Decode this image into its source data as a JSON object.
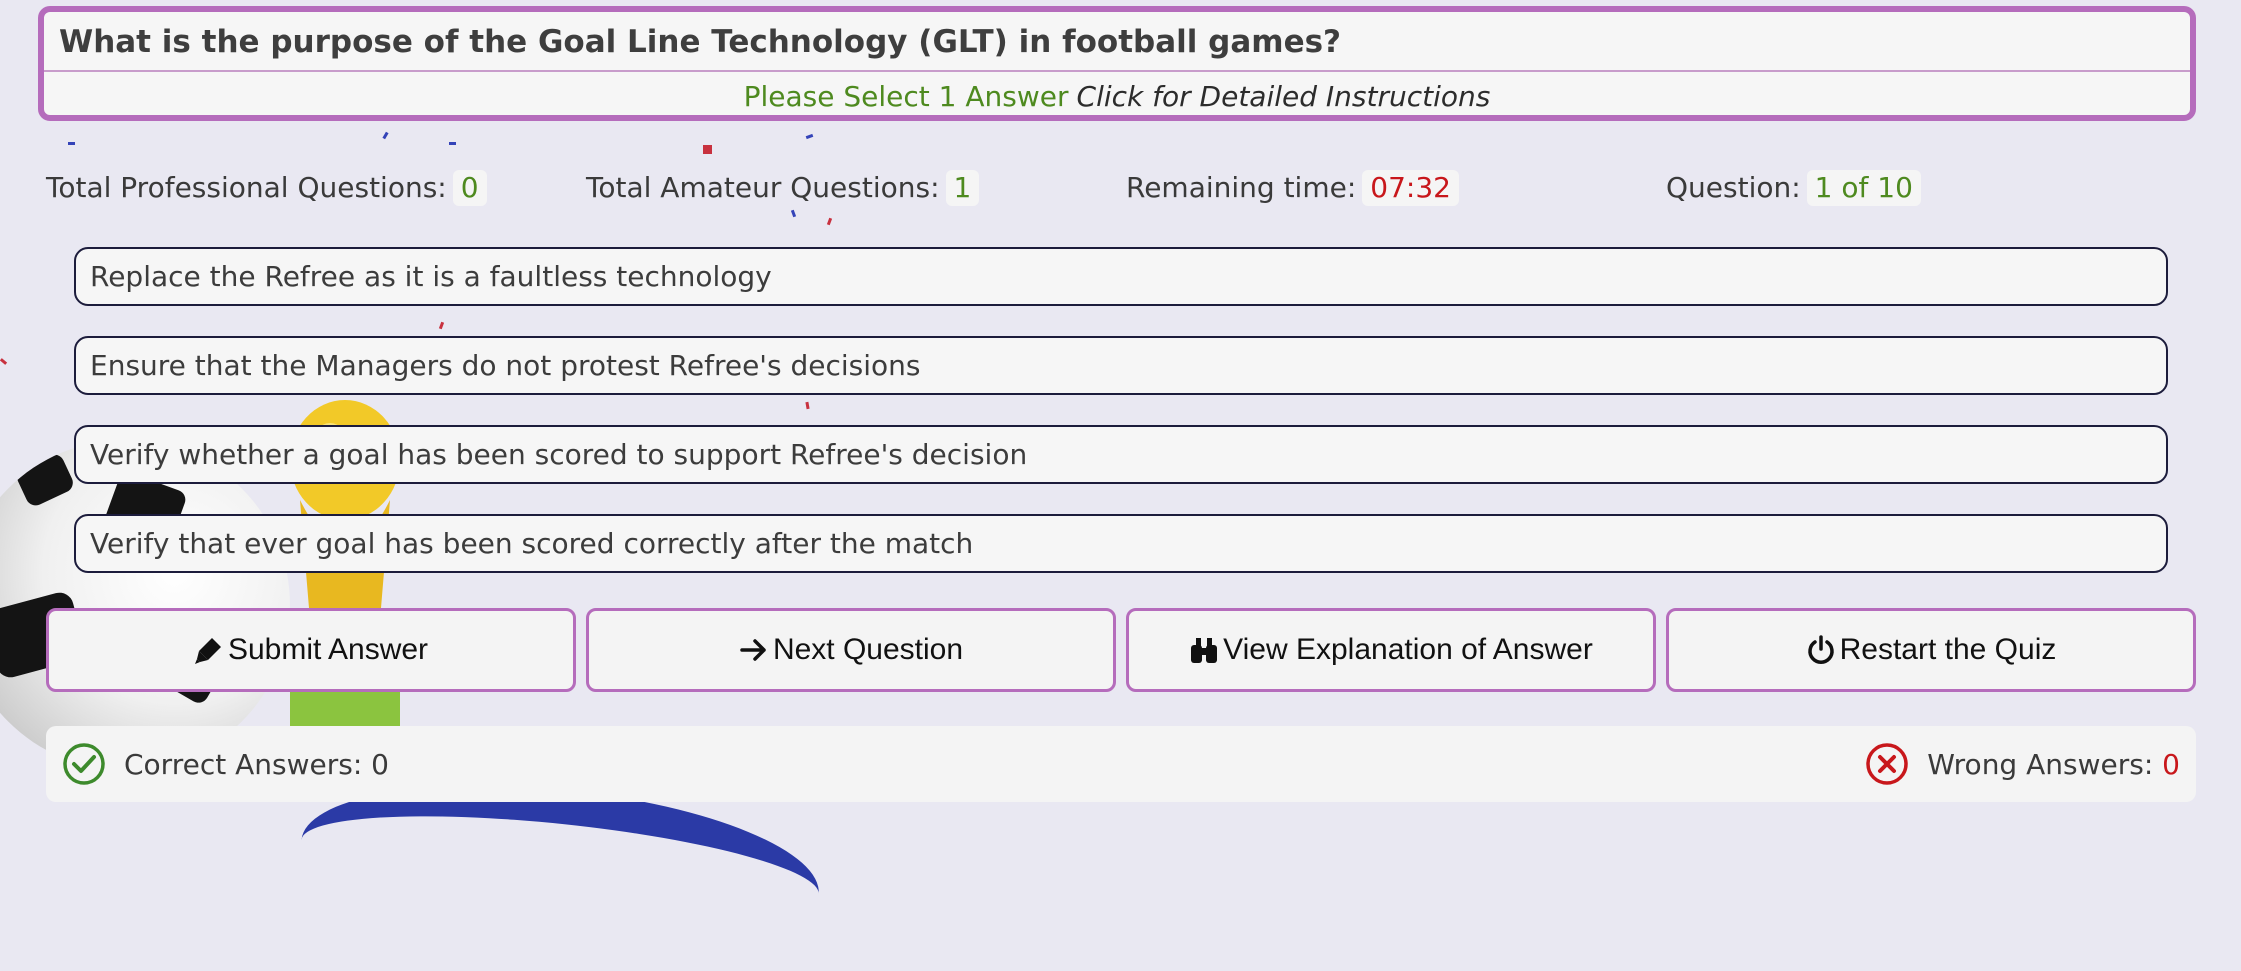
{
  "question": {
    "text": "What is the purpose of the Goal Line Technology (GLT) in football games?",
    "select_prompt": "Please Select 1 Answer",
    "detail_link": "Click for Detailed Instructions"
  },
  "stats": {
    "professional_label": "Total Professional Questions:",
    "professional_value": "0",
    "amateur_label": "Total Amateur Questions:",
    "amateur_value": "1",
    "time_label": "Remaining time:",
    "time_value": "07:32",
    "question_label": "Question:",
    "question_value": "1 of 10"
  },
  "answers": [
    "Replace the Refree as it is a faultless technology",
    "Ensure that the Managers do not protest Refree's decisions",
    "Verify whether a goal has been scored to support Refree's decision",
    "Verify that ever goal has been scored correctly after the match"
  ],
  "buttons": {
    "submit": {
      "label": "Submit Answer",
      "icon": "marker-icon"
    },
    "next": {
      "label": "Next Question",
      "icon": "arrow-right-icon"
    },
    "explain": {
      "label": "View Explanation of Answer",
      "icon": "binoculars-icon"
    },
    "restart": {
      "label": "Restart the Quiz",
      "icon": "power-icon"
    }
  },
  "footer": {
    "correct_label": "Correct Answers:",
    "correct_value": "0",
    "wrong_label": "Wrong Answers:",
    "wrong_value": "0"
  },
  "colors": {
    "accent_border": "#b56cbc",
    "positive": "#4e8a1f",
    "negative": "#c8171b"
  }
}
